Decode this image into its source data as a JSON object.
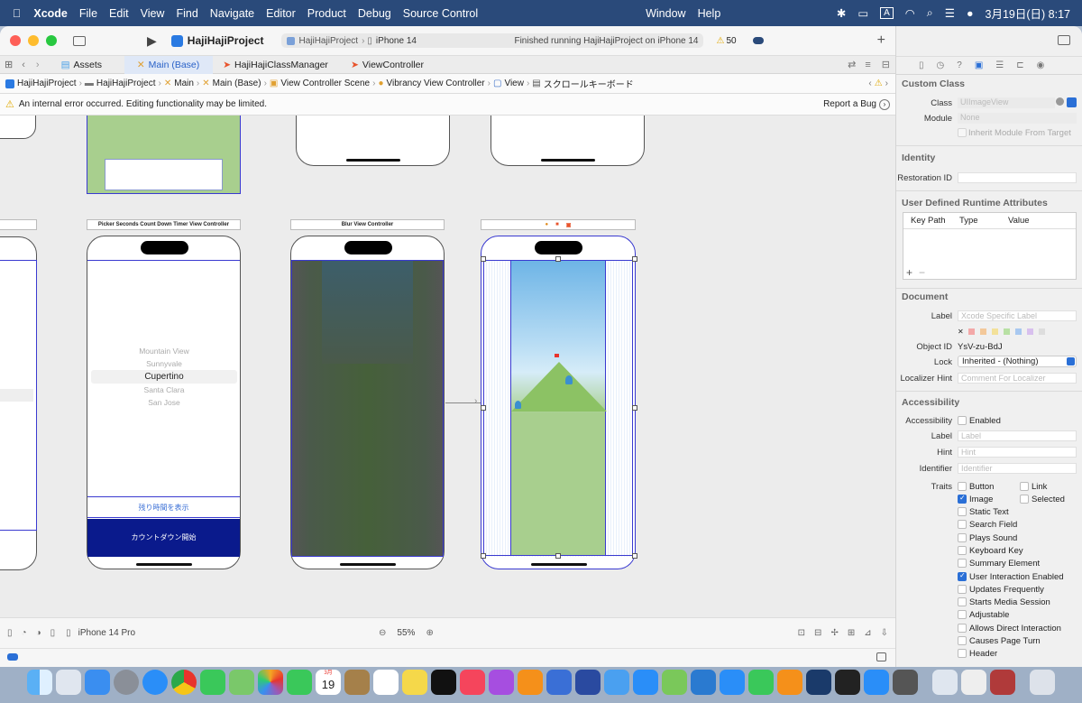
{
  "menubar": {
    "apple": "",
    "app": "Xcode",
    "items": [
      "File",
      "Edit",
      "View",
      "Find",
      "Navigate",
      "Editor",
      "Product",
      "Debug",
      "Source Control"
    ],
    "extra": [
      "Window",
      "Help"
    ],
    "input_mode": "A",
    "datetime": "3月19日(日) 8:17"
  },
  "toolbar": {
    "project": "HajiHajiProject",
    "scheme": "HajiHajiProject",
    "device": "iPhone 14",
    "status": "Finished running HajiHajiProject on iPhone 14",
    "warnings": "50"
  },
  "tabs": [
    {
      "label": "Assets"
    },
    {
      "label": "Main (Base)"
    },
    {
      "label": "HajiHajiClassManager"
    },
    {
      "label": "ViewController"
    }
  ],
  "breadcrumb": [
    "HajiHajiProject",
    "HajiHajiProject",
    "Main",
    "Main (Base)",
    "View Controller Scene",
    "Vibrancy View Controller",
    "View",
    "スクロールキーボード"
  ],
  "error": {
    "message": "An internal error occurred. Editing functionality may be limited.",
    "report": "Report a Bug"
  },
  "canvas": {
    "picker_title": "Picker Seconds Count Down Timer View Controller",
    "picker_items": [
      "Mountain View",
      "Sunnyvale",
      "Cupertino",
      "Santa Clara",
      "San Jose"
    ],
    "show_remaining": "残り時間を表示",
    "start_countdown": "カウントダウン開始",
    "blur_title": "Blur View Controller"
  },
  "bottombar": {
    "device": "iPhone 14 Pro",
    "zoom": "55%"
  },
  "inspector": {
    "custom_class": {
      "title": "Custom Class",
      "class_label": "Class",
      "class_placeholder": "UIImageView",
      "module_label": "Module",
      "module_placeholder": "None",
      "inherit": "Inherit Module From Target"
    },
    "identity": {
      "title": "Identity",
      "restoration_label": "Restoration ID"
    },
    "udra": {
      "title": "User Defined Runtime Attributes",
      "cols": [
        "Key Path",
        "Type",
        "Value"
      ]
    },
    "document": {
      "title": "Document",
      "label_label": "Label",
      "label_placeholder": "Xcode Specific Label",
      "object_id_label": "Object ID",
      "object_id": "YsV-zu-BdJ",
      "lock_label": "Lock",
      "lock_value": "Inherited - (Nothing)",
      "localizer_label": "Localizer Hint",
      "localizer_placeholder": "Comment For Localizer"
    },
    "accessibility": {
      "title": "Accessibility",
      "acc_label": "Accessibility",
      "enabled": "Enabled",
      "label_label": "Label",
      "label_placeholder": "Label",
      "hint_label": "Hint",
      "hint_placeholder": "Hint",
      "identifier_label": "Identifier",
      "identifier_placeholder": "Identifier",
      "traits_label": "Traits",
      "traits": [
        {
          "label": "Button",
          "checked": false
        },
        {
          "label": "Link",
          "checked": false
        },
        {
          "label": "Image",
          "checked": true
        },
        {
          "label": "Selected",
          "checked": false
        },
        {
          "label": "Static Text",
          "checked": false
        },
        {
          "label": "Search Field",
          "checked": false
        },
        {
          "label": "Plays Sound",
          "checked": false
        },
        {
          "label": "Keyboard Key",
          "checked": false
        },
        {
          "label": "Summary Element",
          "checked": false
        },
        {
          "label": "User Interaction Enabled",
          "checked": true
        },
        {
          "label": "Updates Frequently",
          "checked": false
        },
        {
          "label": "Starts Media Session",
          "checked": false
        },
        {
          "label": "Adjustable",
          "checked": false
        },
        {
          "label": "Allows Direct Interaction",
          "checked": false
        },
        {
          "label": "Causes Page Turn",
          "checked": false
        },
        {
          "label": "Header",
          "checked": false
        }
      ]
    }
  },
  "dock": {
    "calendar_month": "3月",
    "calendar_day": "19"
  },
  "colors": {
    "accent": "#2a6fd6",
    "countdown_button": "#0a1a8c",
    "sky": "#7fbfe8",
    "grass": "#a8cf8e"
  }
}
